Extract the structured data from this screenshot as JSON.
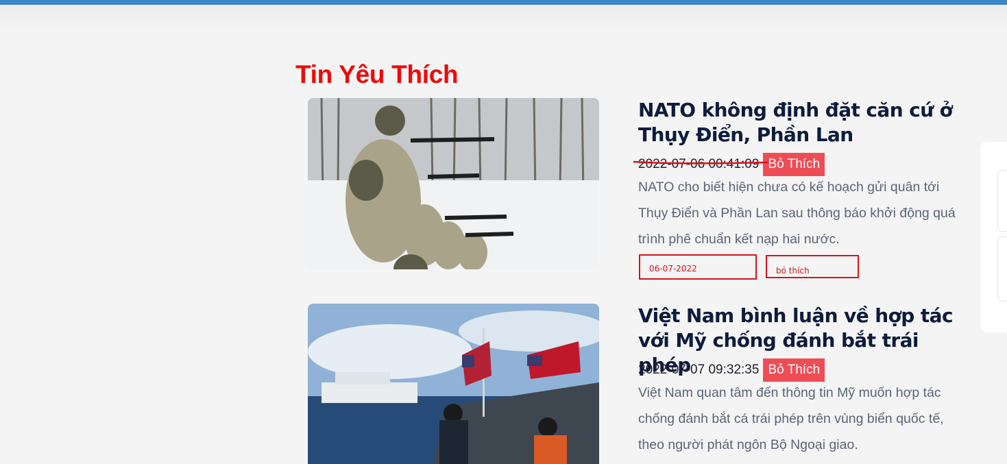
{
  "section": {
    "title": "Tin Yêu Thích"
  },
  "articles": [
    {
      "title": "NATO không định đặt căn cứ ở Thụy Điển, Phần Lan",
      "datetime": "2022-07-06 00:41:09",
      "unlike_label": "Bỏ Thích",
      "summary": "NATO cho biết hiện chưa có kế hoạch gửi quân tới Thụy Điển và Phần Lan sau thông báo khởi động quá trình phê chuẩn kết nạp hai nước.",
      "image": "soldiers-in-snow-photo"
    },
    {
      "title": "Việt Nam bình luận về hợp tác với Mỹ chống đánh bắt trái phép",
      "datetime": "2022-07-07 09:32:35",
      "unlike_label": "Bỏ Thích",
      "summary": "Việt Nam quan tâm đến thông tin Mỹ muốn hợp tác chống đánh bắt cá trái phép trên vùng biển quốc tế, theo người phát ngôn Bộ Ngoại giao.",
      "image": "coast-guard-boat-photo"
    }
  ],
  "annotations": {
    "date_note": "06-07-2022",
    "unlike_note": "bỏ thích"
  },
  "colors": {
    "accent_bar": "#3a86c6",
    "title_red": "#ee0a0a",
    "button_red": "#ef4d56",
    "annotation_red": "#d9101a"
  }
}
